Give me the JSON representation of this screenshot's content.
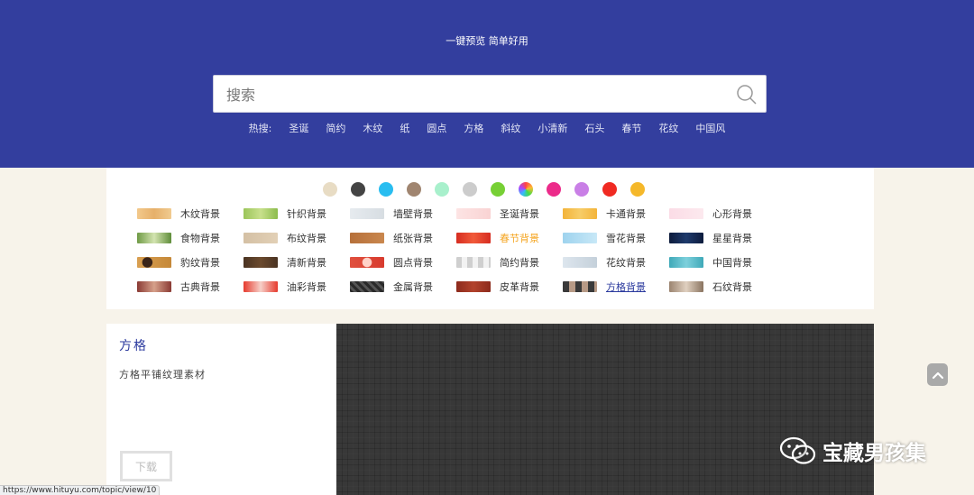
{
  "header": {
    "tagline": "一键预览 简单好用",
    "search_placeholder": "搜索",
    "hot_label": "热搜:",
    "hot_items": [
      "圣诞",
      "简约",
      "木纹",
      "纸",
      "圆点",
      "方格",
      "斜纹",
      "小清新",
      "石头",
      "春节",
      "花纹",
      "中国风"
    ]
  },
  "colors": [
    "#e8dcc4",
    "#444444",
    "#29bdf0",
    "#a08570",
    "#a8f0cc",
    "#cccccc",
    "#77d035",
    "rainbow",
    "#ec2b8a",
    "#c97fe6",
    "#f02a22",
    "#f5b82a"
  ],
  "categories": [
    {
      "label": "木纹背景",
      "thumb": "linear-gradient(90deg,#f3c98c,#e6b06a,#f0cb90)"
    },
    {
      "label": "针织背景",
      "thumb": "linear-gradient(90deg,#9bc55a,#c8e08c,#8cbc4c)"
    },
    {
      "label": "墙壁背景",
      "thumb": "linear-gradient(90deg,#e6ebef,#d7dde2)"
    },
    {
      "label": "圣诞背景",
      "thumb": "linear-gradient(90deg,#fde4e4,#f9d3d3)"
    },
    {
      "label": "卡通背景",
      "thumb": "linear-gradient(90deg,#f3b43a,#f7cd68,#f3b43a)"
    },
    {
      "label": "心形背景",
      "thumb": "linear-gradient(90deg,#fbdce6,#fce9ee)"
    },
    {
      "label": "食物背景",
      "thumb": "linear-gradient(90deg,#6f9a46,#d3e4b0,#5f8d3a)"
    },
    {
      "label": "布纹背景",
      "thumb": "linear-gradient(90deg,#d4c0a4,#e2d0b6)"
    },
    {
      "label": "纸张背景",
      "thumb": "linear-gradient(90deg,#b6703a,#c9874e)"
    },
    {
      "label": "春节背景",
      "thumb": "linear-gradient(90deg,#d62c20,#f15a3a,#d62c20)"
    },
    {
      "label": "雪花背景",
      "thumb": "linear-gradient(90deg,#9ed3ee,#c8e8f7)"
    },
    {
      "label": "星星背景",
      "thumb": "linear-gradient(90deg,#0d1b3c,#1e3a6c,#0d1b3c)"
    },
    {
      "label": "豹纹背景",
      "thumb": "radial-gradient(circle at 30% 50%,#3a2418 20%,transparent 22%),linear-gradient(90deg,#d9a052,#c58838)"
    },
    {
      "label": "清新背景",
      "thumb": "linear-gradient(90deg,#4a3322,#6b4a2e,#4a3322)"
    },
    {
      "label": "圆点背景",
      "thumb": "radial-gradient(circle,#ffd2c8 25%,transparent 28%),linear-gradient(90deg,#e0503e,#d83b2e)"
    },
    {
      "label": "简约背景",
      "thumb": "repeating-linear-gradient(90deg,#cfcfcf 0 6px,#f2f2f2 6px 12px)"
    },
    {
      "label": "花纹背景",
      "thumb": "linear-gradient(90deg,#dde6ee,#c4d0da)"
    },
    {
      "label": "中国背景",
      "thumb": "linear-gradient(90deg,#3fa9b8,#7dd0dc,#3fa9b8)"
    },
    {
      "label": "古典背景",
      "thumb": "linear-gradient(90deg,#8a3a34,#d6a08a,#8a3a34)"
    },
    {
      "label": "油彩背景",
      "thumb": "linear-gradient(90deg,#e63a2e,#f6d0c8,#e63a2e)"
    },
    {
      "label": "金属背景",
      "thumb": "repeating-linear-gradient(45deg,#2a2a2a 0 3px,#555 3px 6px)"
    },
    {
      "label": "皮革背景",
      "thumb": "linear-gradient(90deg,#8c2a1c,#b2432c,#8c2a1c)"
    },
    {
      "label": "方格背景",
      "thumb": "repeating-linear-gradient(90deg,#3a3a3a 0 7px,#b79a86 7px 14px)"
    },
    {
      "label": "石纹背景",
      "thumb": "linear-gradient(90deg,#9b8470,#e0d0c0,#8a7460)"
    }
  ],
  "highlight_orange_index": 9,
  "highlight_link_index": 22,
  "detail": {
    "title": "方格",
    "description": "方格平铺纹理素材",
    "download_label": "下载"
  },
  "watermark": {
    "text": "宝藏男孩集"
  },
  "status_url": "https://www.hituyu.com/topic/view/10"
}
